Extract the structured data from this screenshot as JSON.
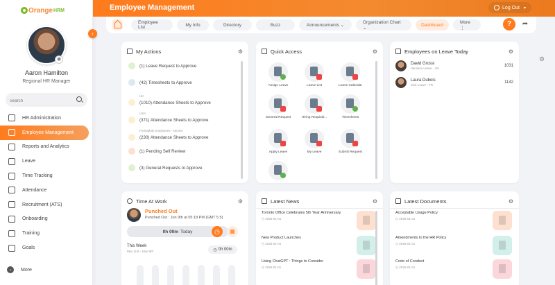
{
  "app": {
    "logo_name": "Orange",
    "logo_hrm": "HRM",
    "logo_tagline": "",
    "page_title": "Employee Management",
    "logout_label": "Log Out",
    "accent": "#ff7b1d"
  },
  "user": {
    "name": "Aaron Hamilton",
    "role": "Regional HR Manager"
  },
  "search": {
    "placeholder": "Search"
  },
  "sidebar": {
    "items": [
      {
        "label": "HR Administration",
        "icon": "hr-admin-icon"
      },
      {
        "label": "Employee Management",
        "icon": "employee-icon",
        "active": true
      },
      {
        "label": "Reports and Analytics",
        "icon": "reports-icon"
      },
      {
        "label": "Leave",
        "icon": "leave-icon"
      },
      {
        "label": "Time Tracking",
        "icon": "time-icon"
      },
      {
        "label": "Attendance",
        "icon": "attendance-icon"
      },
      {
        "label": "Recruitment (ATS)",
        "icon": "recruitment-icon"
      },
      {
        "label": "Onboarding",
        "icon": "onboarding-icon"
      },
      {
        "label": "Training",
        "icon": "training-icon"
      },
      {
        "label": "Goals",
        "icon": "goals-icon"
      }
    ],
    "more_label": "More"
  },
  "tabs": [
    {
      "label": "Employee List"
    },
    {
      "label": "My Info"
    },
    {
      "label": "Directory"
    },
    {
      "label": "Buzz"
    },
    {
      "label": "Announcements ⌄"
    },
    {
      "label": "Organization Chart ⌄"
    },
    {
      "label": "Dashboard",
      "active": true
    },
    {
      "label": "More ⋮"
    }
  ],
  "widgets": {
    "my_actions": {
      "title": "My Actions",
      "items": [
        {
          "label": "(1) Leave Request to Approve",
          "sub": "",
          "color": "#9bd36b"
        },
        {
          "label": "(42) Timesheets to Approve",
          "sub": "",
          "color": "#8fb3cf"
        },
        {
          "label": "(1010) Attendance Sheets to Approve",
          "sub": "UK",
          "color": "#f5c66a"
        },
        {
          "label": "(371) Attendance Sheets to Approve",
          "sub": "USA",
          "color": "#f5c66a"
        },
        {
          "label": "(230) Attendance Sheets to Approve",
          "sub": "Fortnightly Employees - service",
          "color": "#f5c66a"
        },
        {
          "label": "(1) Pending Self Review",
          "sub": "",
          "color": "#f08a4b"
        },
        {
          "label": "(3) General Requests to Approve",
          "sub": "",
          "color": "#9bd36b"
        }
      ]
    },
    "quick_access": {
      "title": "Quick Access",
      "items": [
        {
          "label": "Assign Leave",
          "mark": "green"
        },
        {
          "label": "Leave List",
          "mark": "red"
        },
        {
          "label": "Leave Calendar",
          "mark": "red"
        },
        {
          "label": "General Request",
          "mark": "red"
        },
        {
          "label": "Hiring Requisiti...",
          "mark": "red"
        },
        {
          "label": "Timesheets",
          "mark": "green"
        },
        {
          "label": "Apply Leave",
          "mark": "red"
        },
        {
          "label": "My Leave",
          "mark": "red"
        },
        {
          "label": "Submit Request",
          "mark": "red"
        },
        {
          "label": "",
          "mark": "green"
        }
      ]
    },
    "on_leave": {
      "title": "Employees on Leave Today",
      "items": [
        {
          "name": "David Grossi",
          "type": "Vacation Leave - US",
          "id": "1031"
        },
        {
          "name": "Laura Dubois",
          "type": "Sick Leave - FR",
          "id": "1142"
        }
      ]
    },
    "time_at_work": {
      "title": "Time At Work",
      "status": "Punched Out",
      "detail": "Punched Out : Jun 9th at 05:18 PM (GMT 5.5)",
      "today_value": "0h 00m",
      "today_label": "Today",
      "week_label": "This Week",
      "week_range": "Mar 2nd - Mar 8th",
      "week_value": "0h 00m"
    },
    "latest_news": {
      "title": "Latest News",
      "items": [
        {
          "title": "Toronto Office Celebrates 5th Year Anniversary",
          "date": "2025-01-01",
          "color": "#fde0cf"
        },
        {
          "title": "New Product Launches",
          "date": "2025-01-01",
          "color": "#d3efe9"
        },
        {
          "title": "Using ChatGPT : Things to Consider",
          "date": "2025-01-01",
          "color": "#fbd6db"
        }
      ]
    },
    "latest_documents": {
      "title": "Latest Documents",
      "items": [
        {
          "title": "Acceptable Usage Policy",
          "date": "2025-01-01",
          "color": "#fde0cf"
        },
        {
          "title": "Amendments to the HR Policy",
          "date": "2025-01-01",
          "color": "#d3efe9"
        },
        {
          "title": "Code of Conduct",
          "date": "2025-01-01",
          "color": "#fbd6db"
        }
      ]
    }
  }
}
